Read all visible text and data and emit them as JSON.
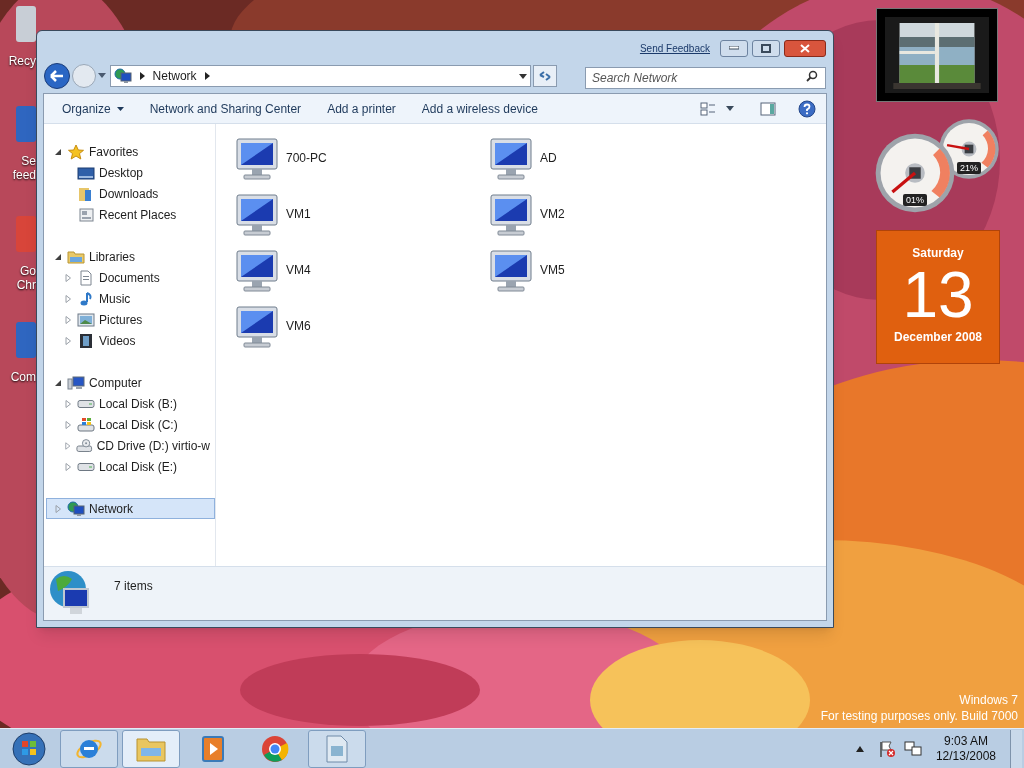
{
  "desktop_icons": [
    {
      "lines": [
        "Recy"
      ]
    },
    {
      "lines": [
        "Se",
        "feed"
      ]
    },
    {
      "lines": [
        "Go",
        "Chr"
      ]
    },
    {
      "lines": [
        "Com"
      ]
    }
  ],
  "window": {
    "feedback_link": "Send Feedback",
    "address": {
      "crumbs": [
        "Network"
      ]
    },
    "search": {
      "placeholder": "Search Network"
    },
    "toolbar": [
      {
        "label": "Organize",
        "kind": "menu"
      },
      {
        "label": "Network and Sharing Center",
        "kind": "command"
      },
      {
        "label": "Add a printer",
        "kind": "command"
      },
      {
        "label": "Add a wireless device",
        "kind": "command"
      }
    ],
    "nav": [
      {
        "label": "Favorites",
        "kind": "star",
        "expanded": true,
        "selected": false,
        "children": [
          {
            "label": "Desktop",
            "kind": "desktop",
            "selected": false
          },
          {
            "label": "Downloads",
            "kind": "downloads",
            "selected": false
          },
          {
            "label": "Recent Places",
            "kind": "recent",
            "selected": false
          }
        ]
      },
      {
        "label": "Libraries",
        "kind": "library",
        "expanded": true,
        "selected": false,
        "children": [
          {
            "label": "Documents",
            "kind": "document",
            "expanded": false,
            "selected": false
          },
          {
            "label": "Music",
            "kind": "music",
            "expanded": false,
            "selected": false
          },
          {
            "label": "Pictures",
            "kind": "pictures",
            "expanded": false,
            "selected": false
          },
          {
            "label": "Videos",
            "kind": "videos",
            "expanded": false,
            "selected": false
          }
        ]
      },
      {
        "label": "Computer",
        "kind": "computer",
        "expanded": true,
        "selected": false,
        "children": [
          {
            "label": "Local Disk (B:)",
            "kind": "disk",
            "expanded": false,
            "selected": false
          },
          {
            "label": "Local Disk (C:)",
            "kind": "system-disk",
            "expanded": false,
            "selected": false
          },
          {
            "label": "CD Drive (D:) virtio-w",
            "kind": "cd",
            "expanded": false,
            "selected": false
          },
          {
            "label": "Local Disk (E:)",
            "kind": "disk",
            "expanded": false,
            "selected": false
          }
        ]
      },
      {
        "label": "Network",
        "kind": "network",
        "expanded": false,
        "selected": true
      }
    ],
    "items": [
      {
        "name": "700-PC"
      },
      {
        "name": "AD"
      },
      {
        "name": "VM1"
      },
      {
        "name": "VM2"
      },
      {
        "name": "VM4"
      },
      {
        "name": "VM5"
      },
      {
        "name": "VM6"
      }
    ],
    "status_bar": {
      "count": "7 items"
    }
  },
  "gadgets": {
    "cpu_meter": {
      "gauges": [
        {
          "reading": "01%"
        },
        {
          "reading": "21%"
        }
      ]
    },
    "calendar": {
      "weekday": "Saturday",
      "day": "13",
      "month_year": "December 2008"
    }
  },
  "build_notice": [
    "Windows 7",
    "For testing purposes only. Build 7000"
  ],
  "taskbar": {
    "buttons": [
      {
        "kind": "ie",
        "running": true,
        "selected": false
      },
      {
        "kind": "explorer",
        "running": true,
        "selected": true
      },
      {
        "kind": "media",
        "running": false,
        "selected": false
      },
      {
        "kind": "chrome",
        "running": false,
        "selected": false
      },
      {
        "kind": "document",
        "running": true,
        "selected": false
      }
    ],
    "clock": {
      "time": "9:03 AM",
      "date": "12/13/2008"
    }
  }
}
